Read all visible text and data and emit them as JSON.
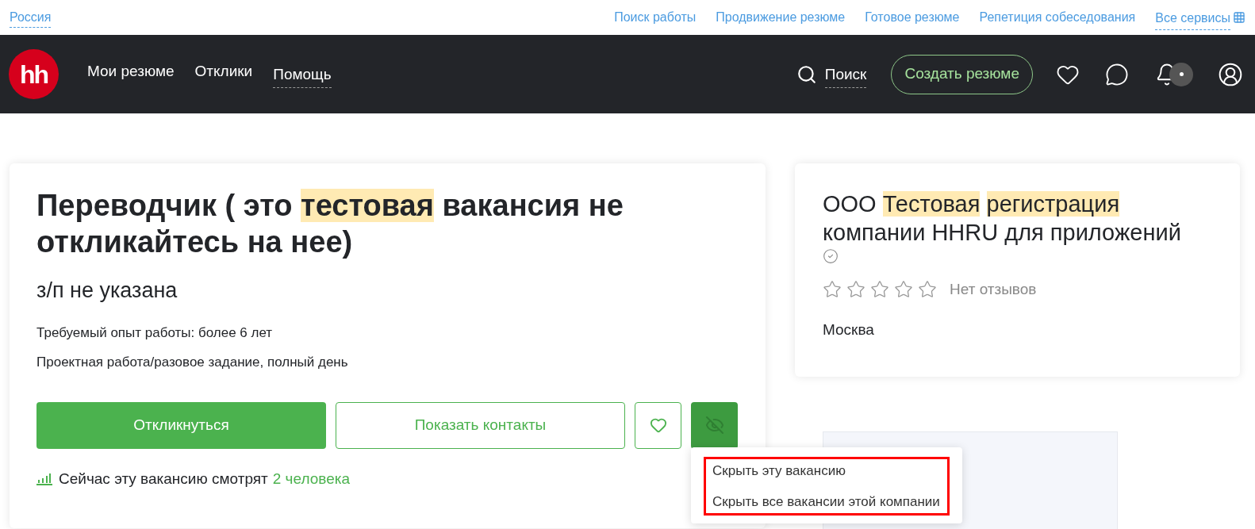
{
  "region": "Россия",
  "top_links": [
    "Поиск работы",
    "Продвижение резюме",
    "Готовое резюме",
    "Репетиция собеседования",
    "Все сервисы"
  ],
  "logo": "hh",
  "nav": [
    {
      "label": "Мои резюме",
      "selected": false
    },
    {
      "label": "Отклики",
      "selected": false
    },
    {
      "label": "Помощь",
      "selected": true
    }
  ],
  "search": "Поиск",
  "create_button": "Создать резюме",
  "vacancy": {
    "title_parts": [
      {
        "text": "Переводчик ( это",
        "highlighted": false
      },
      {
        "text": "тестовая",
        "highlighted": true
      },
      {
        "text": "вакансия не откликайтесь на нее)",
        "highlighted": false
      }
    ],
    "salary": "з/п не указана",
    "experience": "Требуемый опыт работы: более 6 лет",
    "employment": "Проектная работа/разовое задание, полный день",
    "apply_button": "Откликнуться",
    "contacts_button": "Показать контакты",
    "viewers_text": "Сейчас эту вакансию смотрят",
    "viewers_count": "2 человека"
  },
  "hide_menu": {
    "items": [
      "Скрыть эту вакансию",
      "Скрыть все вакансии этой компании"
    ]
  },
  "company": {
    "name_parts": [
      {
        "text": "ООО",
        "highlighted": false
      },
      {
        "text": "Тестовая",
        "highlighted": true
      },
      {
        "text": "регистрация",
        "highlighted": true
      },
      {
        "text": "компании HHRU для приложений",
        "highlighted": false
      }
    ],
    "stars": 0,
    "reviews": "Нет отзывов",
    "city": "Москва"
  }
}
